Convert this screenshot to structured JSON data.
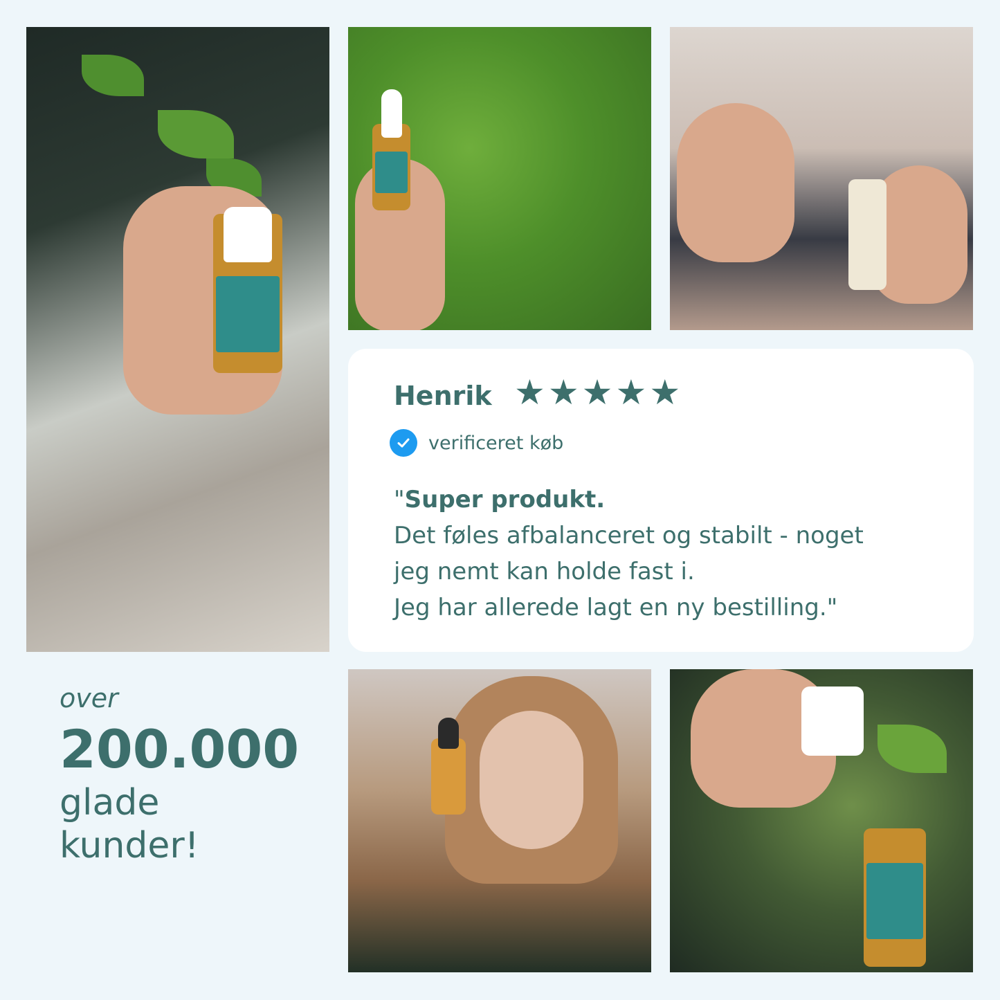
{
  "review": {
    "name": "Henrik",
    "stars": [
      "★",
      "★",
      "★",
      "★",
      "★"
    ],
    "rating": 5,
    "verified_label": "verificeret køb",
    "quote_open": "\"",
    "headline": "Super produkt.",
    "body_lines": [
      "Det føles afbalanceret og stabilt - noget",
      "jeg nemt kan holde fast i.",
      "Jeg har allerede lagt en ny bestilling.\""
    ]
  },
  "stat": {
    "prefix": "over",
    "number": "200.000",
    "suffix_line1": "glade",
    "suffix_line2": "kunder!"
  },
  "colors": {
    "background": "#eef6fa",
    "text": "#3d6f6c",
    "card": "#ffffff",
    "verified_badge": "#1d9bf0"
  },
  "icons": [
    "star-icon",
    "verified-check-icon"
  ]
}
